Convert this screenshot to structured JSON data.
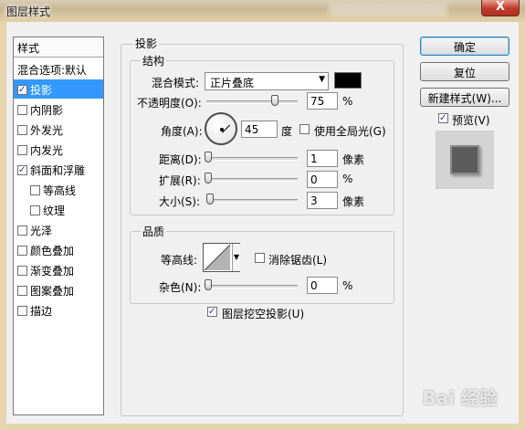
{
  "window": {
    "title": "图层样式",
    "close_glyph": "X"
  },
  "sidebar": {
    "header": "样式",
    "items": [
      {
        "label": "混合选项:默认",
        "checkbox": false
      },
      {
        "label": "投影",
        "checkbox": true,
        "checked": true,
        "selected": true
      },
      {
        "label": "内阴影",
        "checkbox": true,
        "checked": false
      },
      {
        "label": "外发光",
        "checkbox": true,
        "checked": false
      },
      {
        "label": "内发光",
        "checkbox": true,
        "checked": false
      },
      {
        "label": "斜面和浮雕",
        "checkbox": true,
        "checked": true
      },
      {
        "label": "等高线",
        "checkbox": true,
        "checked": false,
        "indent": true
      },
      {
        "label": "纹理",
        "checkbox": true,
        "checked": false,
        "indent": true
      },
      {
        "label": "光泽",
        "checkbox": true,
        "checked": false
      },
      {
        "label": "颜色叠加",
        "checkbox": true,
        "checked": false
      },
      {
        "label": "渐变叠加",
        "checkbox": true,
        "checked": false
      },
      {
        "label": "图案叠加",
        "checkbox": true,
        "checked": false
      },
      {
        "label": "描边",
        "checkbox": true,
        "checked": false
      }
    ]
  },
  "drop_shadow": {
    "title": "投影",
    "structure": {
      "title": "结构",
      "blend_mode_label": "混合模式:",
      "blend_mode_value": "正片叠底",
      "color": "#000000",
      "opacity_label": "不透明度(O):",
      "opacity_value": "75",
      "opacity_fraction": 0.75,
      "percent": "%",
      "angle_label": "角度(A):",
      "angle_value": "45",
      "degree_unit": "度",
      "global_light_label": "使用全局光(G)",
      "global_light_checked": false,
      "distance_label": "距离(D):",
      "distance_value": "1",
      "spread_label": "扩展(R):",
      "spread_value": "0",
      "size_label": "大小(S):",
      "size_value": "3",
      "pixel_unit": "像素"
    },
    "quality": {
      "title": "品质",
      "contour_label": "等高线:",
      "anti_alias_label": "消除锯齿(L)",
      "anti_alias_checked": false,
      "noise_label": "杂色(N):",
      "noise_value": "0",
      "percent": "%"
    },
    "knockout_label": "图层挖空投影(U)",
    "knockout_checked": true
  },
  "buttons": {
    "ok": "确定",
    "reset": "复位",
    "new_style": "新建样式(W)...",
    "preview_label": "预览(V)",
    "preview_checked": true
  },
  "watermark": "Bai 经验",
  "icons": [
    "close-icon",
    "dropdown-arrow-icon",
    "angle-dial-icon",
    "contour-curve-icon",
    "checkmark-icon"
  ]
}
